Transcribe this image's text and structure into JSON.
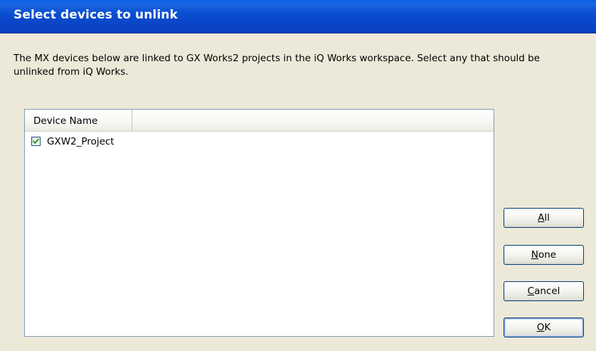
{
  "dialog": {
    "title": "Select devices to unlink",
    "description": "The MX devices below are linked to GX Works2 projects in the iQ Works workspace. Select any that should be unlinked from iQ Works."
  },
  "list": {
    "column_header": "Device Name",
    "items": [
      {
        "label": "GXW2_Project",
        "checked": true
      }
    ]
  },
  "buttons": {
    "all": {
      "mnemonic": "A",
      "rest": "ll"
    },
    "none": {
      "mnemonic": "N",
      "rest": "one"
    },
    "cancel": {
      "mnemonic": "C",
      "rest": "ancel"
    },
    "ok": {
      "mnemonic": "O",
      "rest": "K"
    }
  },
  "colors": {
    "titlebar": "#0a46c8",
    "dialog_bg": "#ece9d8",
    "list_border": "#7f9db9",
    "checkmark": "#21a121"
  }
}
